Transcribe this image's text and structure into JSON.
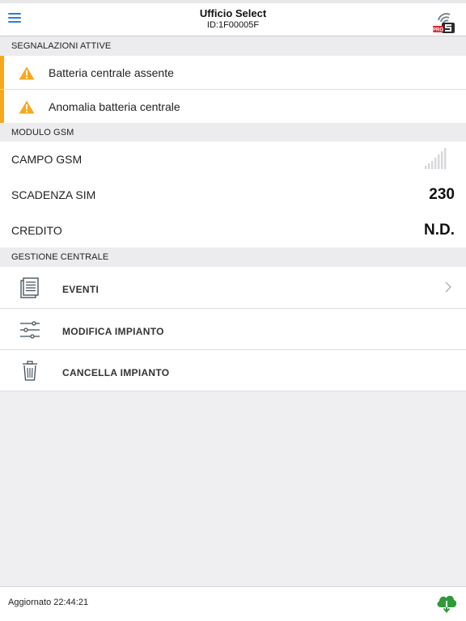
{
  "header": {
    "title": "Ufficio Select",
    "subtitle": "ID:1F00005F",
    "brand_badge": "PRO"
  },
  "alerts": {
    "section_title": "SEGNALAZIONI ATTIVE",
    "items": [
      {
        "label": "Batteria centrale assente",
        "icon": "warning-icon"
      },
      {
        "label": "Anomalia batteria centrale",
        "icon": "warning-icon"
      }
    ]
  },
  "gsm": {
    "section_title": "MODULO GSM",
    "field_label": "CAMPO GSM",
    "signal_level": 0,
    "sim_label": "SCADENZA SIM",
    "sim_value": "230",
    "credit_label": "CREDITO",
    "credit_value": "N.D."
  },
  "management": {
    "section_title": "GESTIONE CENTRALE",
    "items": [
      {
        "label": "EVENTI",
        "icon": "document-list-icon"
      },
      {
        "label": "MODIFICA IMPIANTO",
        "icon": "sliders-icon"
      },
      {
        "label": "CANCELLA IMPIANTO",
        "icon": "trash-icon"
      }
    ]
  },
  "footer": {
    "updated": "Aggiornato 22:44:21"
  },
  "colors": {
    "accent": "#2a7fd4",
    "warning": "#f7a81b",
    "download": "#2e9a3a"
  }
}
